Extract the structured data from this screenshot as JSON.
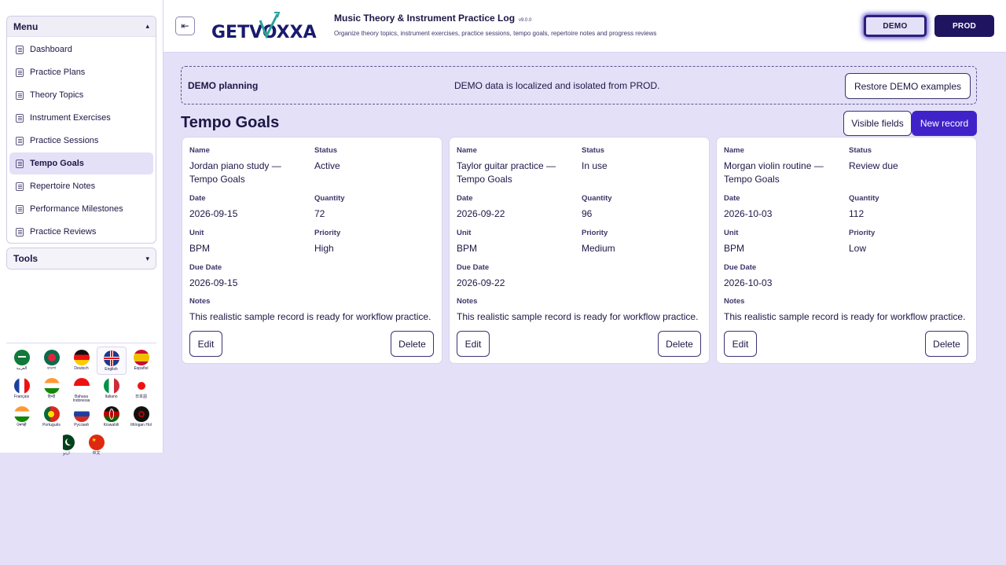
{
  "sidebar": {
    "menu_title": "Menu",
    "tools_title": "Tools",
    "items": [
      {
        "label": "Dashboard"
      },
      {
        "label": "Practice Plans"
      },
      {
        "label": "Theory Topics"
      },
      {
        "label": "Instrument Exercises"
      },
      {
        "label": "Practice Sessions"
      },
      {
        "label": "Tempo Goals",
        "active": true
      },
      {
        "label": "Repertoire Notes"
      },
      {
        "label": "Performance Milestones"
      },
      {
        "label": "Practice Reviews"
      }
    ],
    "languages": [
      {
        "label": "العربية",
        "flag": "sa"
      },
      {
        "label": "বাংলা",
        "flag": "bd"
      },
      {
        "label": "Deutsch",
        "flag": "de"
      },
      {
        "label": "English",
        "flag": "gb",
        "selected": true
      },
      {
        "label": "Español",
        "flag": "es"
      },
      {
        "label": "Français",
        "flag": "fr"
      },
      {
        "label": "हिन्दी",
        "flag": "in"
      },
      {
        "label": "Bahasa Indonesia",
        "flag": "id"
      },
      {
        "label": "Italiano",
        "flag": "it"
      },
      {
        "label": "日本語",
        "flag": "jp"
      },
      {
        "label": "ਪੰਜਾਬੀ",
        "flag": "in"
      },
      {
        "label": "Português",
        "flag": "pt"
      },
      {
        "label": "Русский",
        "flag": "ru"
      },
      {
        "label": "Kiswahili",
        "flag": "ke"
      },
      {
        "label": "tlhIngan Hol",
        "flag": "kl"
      },
      {
        "label": "اردو",
        "flag": "pk"
      },
      {
        "label": "中文",
        "flag": "cn"
      }
    ]
  },
  "header": {
    "logo": "GETVOXXA",
    "title": "Music Theory & Instrument Practice Log",
    "version": "v9.0.0",
    "subtitle": "Organize theory topics, instrument exercises, practice sessions, tempo goals, repertoire notes and progress reviews",
    "env_demo": "DEMO",
    "env_prod": "PROD"
  },
  "banner": {
    "title": "DEMO planning",
    "text": "DEMO data is localized and isolated from PROD.",
    "button": "Restore DEMO examples"
  },
  "page": {
    "title": "Tempo Goals",
    "visible_fields": "Visible fields",
    "new_record": "New record"
  },
  "labels": {
    "name": "Name",
    "status": "Status",
    "date": "Date",
    "quantity": "Quantity",
    "unit": "Unit",
    "priority": "Priority",
    "due_date": "Due Date",
    "notes": "Notes",
    "edit": "Edit",
    "delete": "Delete"
  },
  "records": [
    {
      "name": "Jordan piano study — Tempo Goals",
      "status": "Active",
      "date": "2026-09-15",
      "quantity": "72",
      "unit": "BPM",
      "priority": "High",
      "due_date": "2026-09-15",
      "notes": "This realistic sample record is ready for workflow practice."
    },
    {
      "name": "Taylor guitar practice — Tempo Goals",
      "status": "In use",
      "date": "2026-09-22",
      "quantity": "96",
      "unit": "BPM",
      "priority": "Medium",
      "due_date": "2026-09-22",
      "notes": "This realistic sample record is ready for workflow practice."
    },
    {
      "name": "Morgan violin routine — Tempo Goals",
      "status": "Review due",
      "date": "2026-10-03",
      "quantity": "112",
      "unit": "BPM",
      "priority": "Low",
      "due_date": "2026-10-03",
      "notes": "This realistic sample record is ready for workflow practice."
    }
  ],
  "colors": {
    "accent": "#3f23c9",
    "prod": "#1e145f",
    "background": "#e4e0f7"
  }
}
